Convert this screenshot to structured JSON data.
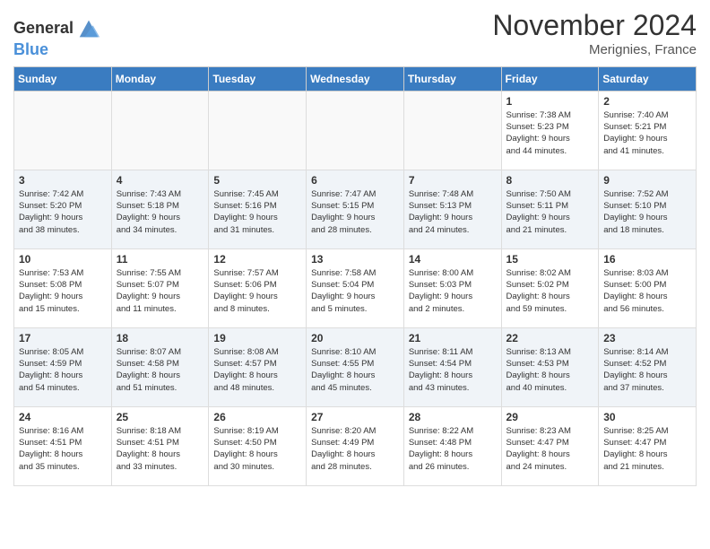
{
  "logo": {
    "text_general": "General",
    "text_blue": "Blue"
  },
  "header": {
    "month_title": "November 2024",
    "location": "Merignies, France"
  },
  "weekdays": [
    "Sunday",
    "Monday",
    "Tuesday",
    "Wednesday",
    "Thursday",
    "Friday",
    "Saturday"
  ],
  "weeks": [
    [
      {
        "day": "",
        "info": "",
        "empty": true
      },
      {
        "day": "",
        "info": "",
        "empty": true
      },
      {
        "day": "",
        "info": "",
        "empty": true
      },
      {
        "day": "",
        "info": "",
        "empty": true
      },
      {
        "day": "",
        "info": "",
        "empty": true
      },
      {
        "day": "1",
        "info": "Sunrise: 7:38 AM\nSunset: 5:23 PM\nDaylight: 9 hours\nand 44 minutes."
      },
      {
        "day": "2",
        "info": "Sunrise: 7:40 AM\nSunset: 5:21 PM\nDaylight: 9 hours\nand 41 minutes."
      }
    ],
    [
      {
        "day": "3",
        "info": "Sunrise: 7:42 AM\nSunset: 5:20 PM\nDaylight: 9 hours\nand 38 minutes."
      },
      {
        "day": "4",
        "info": "Sunrise: 7:43 AM\nSunset: 5:18 PM\nDaylight: 9 hours\nand 34 minutes."
      },
      {
        "day": "5",
        "info": "Sunrise: 7:45 AM\nSunset: 5:16 PM\nDaylight: 9 hours\nand 31 minutes."
      },
      {
        "day": "6",
        "info": "Sunrise: 7:47 AM\nSunset: 5:15 PM\nDaylight: 9 hours\nand 28 minutes."
      },
      {
        "day": "7",
        "info": "Sunrise: 7:48 AM\nSunset: 5:13 PM\nDaylight: 9 hours\nand 24 minutes."
      },
      {
        "day": "8",
        "info": "Sunrise: 7:50 AM\nSunset: 5:11 PM\nDaylight: 9 hours\nand 21 minutes."
      },
      {
        "day": "9",
        "info": "Sunrise: 7:52 AM\nSunset: 5:10 PM\nDaylight: 9 hours\nand 18 minutes."
      }
    ],
    [
      {
        "day": "10",
        "info": "Sunrise: 7:53 AM\nSunset: 5:08 PM\nDaylight: 9 hours\nand 15 minutes."
      },
      {
        "day": "11",
        "info": "Sunrise: 7:55 AM\nSunset: 5:07 PM\nDaylight: 9 hours\nand 11 minutes."
      },
      {
        "day": "12",
        "info": "Sunrise: 7:57 AM\nSunset: 5:06 PM\nDaylight: 9 hours\nand 8 minutes."
      },
      {
        "day": "13",
        "info": "Sunrise: 7:58 AM\nSunset: 5:04 PM\nDaylight: 9 hours\nand 5 minutes."
      },
      {
        "day": "14",
        "info": "Sunrise: 8:00 AM\nSunset: 5:03 PM\nDaylight: 9 hours\nand 2 minutes."
      },
      {
        "day": "15",
        "info": "Sunrise: 8:02 AM\nSunset: 5:02 PM\nDaylight: 8 hours\nand 59 minutes."
      },
      {
        "day": "16",
        "info": "Sunrise: 8:03 AM\nSunset: 5:00 PM\nDaylight: 8 hours\nand 56 minutes."
      }
    ],
    [
      {
        "day": "17",
        "info": "Sunrise: 8:05 AM\nSunset: 4:59 PM\nDaylight: 8 hours\nand 54 minutes."
      },
      {
        "day": "18",
        "info": "Sunrise: 8:07 AM\nSunset: 4:58 PM\nDaylight: 8 hours\nand 51 minutes."
      },
      {
        "day": "19",
        "info": "Sunrise: 8:08 AM\nSunset: 4:57 PM\nDaylight: 8 hours\nand 48 minutes."
      },
      {
        "day": "20",
        "info": "Sunrise: 8:10 AM\nSunset: 4:55 PM\nDaylight: 8 hours\nand 45 minutes."
      },
      {
        "day": "21",
        "info": "Sunrise: 8:11 AM\nSunset: 4:54 PM\nDaylight: 8 hours\nand 43 minutes."
      },
      {
        "day": "22",
        "info": "Sunrise: 8:13 AM\nSunset: 4:53 PM\nDaylight: 8 hours\nand 40 minutes."
      },
      {
        "day": "23",
        "info": "Sunrise: 8:14 AM\nSunset: 4:52 PM\nDaylight: 8 hours\nand 37 minutes."
      }
    ],
    [
      {
        "day": "24",
        "info": "Sunrise: 8:16 AM\nSunset: 4:51 PM\nDaylight: 8 hours\nand 35 minutes."
      },
      {
        "day": "25",
        "info": "Sunrise: 8:18 AM\nSunset: 4:51 PM\nDaylight: 8 hours\nand 33 minutes."
      },
      {
        "day": "26",
        "info": "Sunrise: 8:19 AM\nSunset: 4:50 PM\nDaylight: 8 hours\nand 30 minutes."
      },
      {
        "day": "27",
        "info": "Sunrise: 8:20 AM\nSunset: 4:49 PM\nDaylight: 8 hours\nand 28 minutes."
      },
      {
        "day": "28",
        "info": "Sunrise: 8:22 AM\nSunset: 4:48 PM\nDaylight: 8 hours\nand 26 minutes."
      },
      {
        "day": "29",
        "info": "Sunrise: 8:23 AM\nSunset: 4:47 PM\nDaylight: 8 hours\nand 24 minutes."
      },
      {
        "day": "30",
        "info": "Sunrise: 8:25 AM\nSunset: 4:47 PM\nDaylight: 8 hours\nand 21 minutes."
      }
    ]
  ]
}
